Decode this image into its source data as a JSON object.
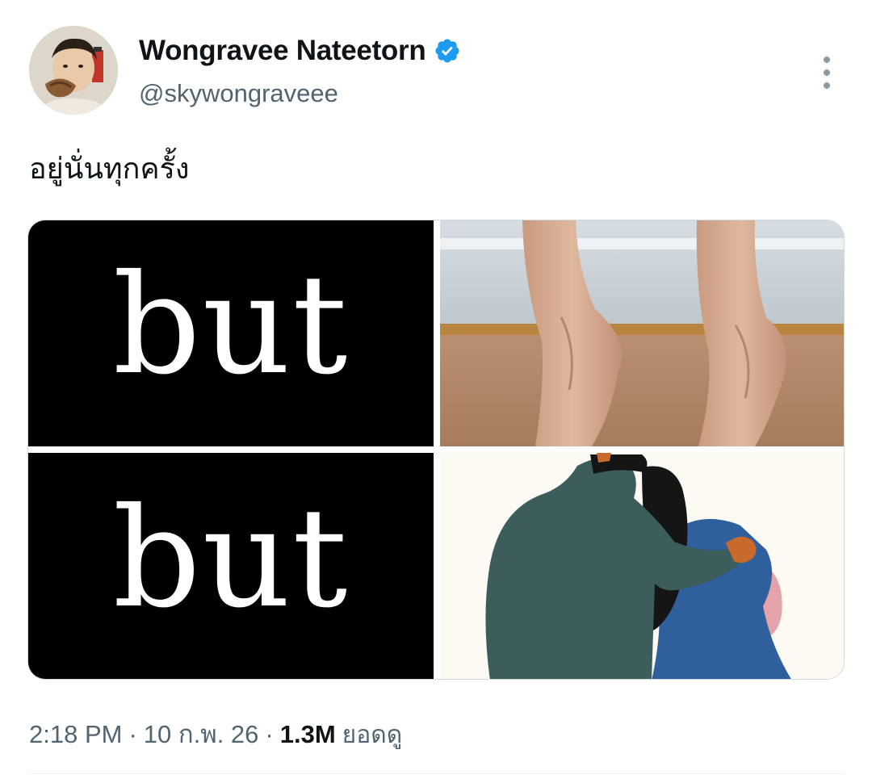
{
  "author": {
    "display_name": "Wongravee Nateetorn",
    "handle": "@skywongraveee",
    "verified": true
  },
  "tweet": {
    "text": "อยู่นั่นทุกครั้ง",
    "media": {
      "top_left_text": "but",
      "bottom_left_text": "but"
    }
  },
  "meta": {
    "time": "2:18 PM",
    "separator": "·",
    "date": "10 ก.พ. 26",
    "views_count": "1.3M",
    "views_label": "ยอดดู"
  },
  "colors": {
    "verified_badge": "#1d9bf0",
    "secondary_text": "#536471",
    "primary_text": "#0f1419"
  },
  "icons": {
    "more": "more-options-icon",
    "verified": "verified-badge-icon"
  }
}
